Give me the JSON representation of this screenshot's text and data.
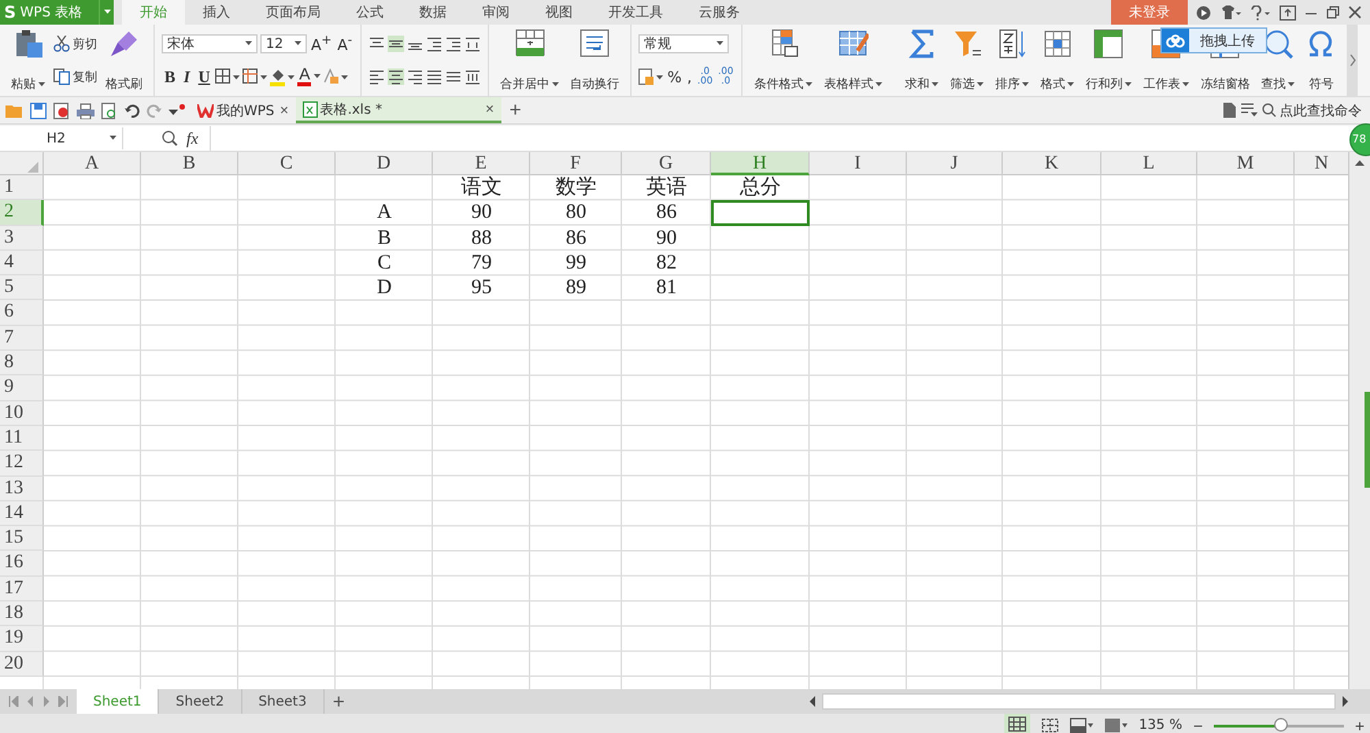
{
  "app_button": {
    "logo": "S",
    "label": "WPS 表格"
  },
  "menu_tabs": [
    {
      "label": "开始",
      "selected": true
    },
    {
      "label": "插入",
      "selected": false
    },
    {
      "label": "页面布局",
      "selected": false
    },
    {
      "label": "公式",
      "selected": false
    },
    {
      "label": "数据",
      "selected": false
    },
    {
      "label": "审阅",
      "selected": false
    },
    {
      "label": "视图",
      "selected": false
    },
    {
      "label": "开发工具",
      "selected": false
    },
    {
      "label": "云服务",
      "selected": false
    }
  ],
  "account_button": "未登录",
  "upload_tip": "拖拽上传",
  "clipboard": {
    "paste": "粘贴",
    "cut": "剪切",
    "copy": "复制",
    "format_painter": "格式刷"
  },
  "font": {
    "name": "宋体",
    "size": "12",
    "size_buttons": [
      "A$^{+}$",
      "A$^{-}$"
    ],
    "style_buttons": [
      "B",
      "I",
      "U"
    ],
    "color_button": "A"
  },
  "align_buttons": [
    {
      "label": "合并居中",
      "menu": true
    },
    {
      "label": "自动换行",
      "menu": false
    }
  ],
  "number": {
    "format": "常规",
    "percent": "%",
    "comma": ",",
    "decimals": [
      {
        "top": ".0",
        "bottom": ".00"
      },
      {
        "top": ".00",
        "bottom": ".0"
      }
    ]
  },
  "ribbon_buttons": [
    {
      "label": "条件格式",
      "menu": true
    },
    {
      "label": "表格样式",
      "menu": true
    },
    {
      "label": "求和",
      "menu": true
    },
    {
      "label": "筛选",
      "menu": true
    },
    {
      "label": "排序",
      "menu": true
    },
    {
      "label": "格式",
      "menu": true
    },
    {
      "label": "行和列",
      "menu": true
    },
    {
      "label": "工作表",
      "menu": true
    },
    {
      "label": "冻结窗格",
      "menu": false
    },
    {
      "label": "查找",
      "menu": true
    },
    {
      "label": "符号",
      "menu": false
    }
  ],
  "doc_tabs": [
    {
      "label": "我的WPS",
      "selected": false,
      "close": "×"
    },
    {
      "label": "表格.xls *",
      "selected": true,
      "close": "×"
    }
  ],
  "new_tab": "+",
  "command_search": "点此查找命令",
  "badge": "78",
  "formula_bar": {
    "name_box": "H2",
    "fx": "fx"
  },
  "sheet": {
    "columns": [
      {
        "label": "A",
        "selected": false
      },
      {
        "label": "B",
        "selected": false
      },
      {
        "label": "C",
        "selected": false
      },
      {
        "label": "D",
        "selected": false
      },
      {
        "label": "E",
        "selected": false
      },
      {
        "label": "F",
        "selected": false
      },
      {
        "label": "G",
        "selected": false
      },
      {
        "label": "H",
        "selected": true
      },
      {
        "label": "I",
        "selected": false
      },
      {
        "label": "J",
        "selected": false
      },
      {
        "label": "K",
        "selected": false
      },
      {
        "label": "L",
        "selected": false
      },
      {
        "label": "M",
        "selected": false
      },
      {
        "label": "N",
        "selected": false
      }
    ],
    "rows": [
      {
        "number": "1",
        "selected": false,
        "cells": [
          null,
          null,
          null,
          null,
          "语文",
          "数学",
          "英语",
          "总分"
        ]
      },
      {
        "number": "2",
        "selected": true,
        "cells": [
          null,
          null,
          null,
          "A",
          "90",
          "80",
          "86"
        ]
      },
      {
        "number": "3",
        "selected": false,
        "cells": [
          null,
          null,
          null,
          "B",
          "88",
          "86",
          "90"
        ]
      },
      {
        "number": "4",
        "selected": false,
        "cells": [
          null,
          null,
          null,
          "C",
          "79",
          "99",
          "82"
        ]
      },
      {
        "number": "5",
        "selected": false,
        "cells": [
          null,
          null,
          null,
          "D",
          "95",
          "89",
          "81"
        ]
      },
      {
        "number": "6",
        "selected": false
      },
      {
        "number": "7",
        "selected": false
      },
      {
        "number": "8",
        "selected": false
      },
      {
        "number": "9",
        "selected": false
      },
      {
        "number": "10",
        "selected": false
      },
      {
        "number": "11",
        "selected": false
      },
      {
        "number": "12",
        "selected": false
      },
      {
        "number": "13",
        "selected": false
      },
      {
        "number": "14",
        "selected": false
      },
      {
        "number": "15",
        "selected": false
      },
      {
        "number": "16",
        "selected": false
      },
      {
        "number": "17",
        "selected": false
      },
      {
        "number": "18",
        "selected": false
      },
      {
        "number": "19",
        "selected": false
      },
      {
        "number": "20",
        "selected": false
      }
    ]
  },
  "sheet_tabs": [
    {
      "label": "Sheet1",
      "selected": true
    },
    {
      "label": "Sheet2",
      "selected": false
    },
    {
      "label": "Sheet3",
      "selected": false
    }
  ],
  "add_sheet": "+",
  "zoom": {
    "reading": "135 %",
    "out": "−",
    "in": "+",
    "level": 0.52
  }
}
